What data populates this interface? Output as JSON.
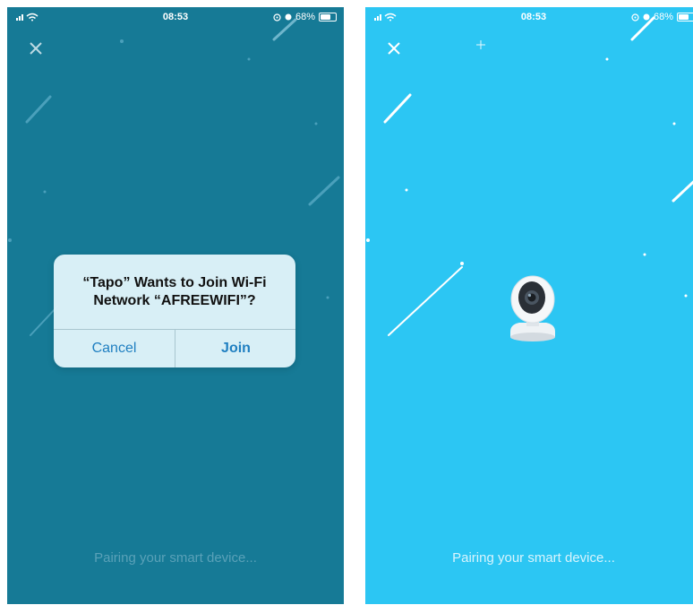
{
  "left_screen": {
    "status": {
      "time": "08:53",
      "battery": "68%",
      "battery_level": 0.68
    },
    "dialog": {
      "title_line1": "“Tapo” Wants to Join Wi-Fi",
      "title_line2": "Network “AFREEWIFI”?",
      "cancel_label": "Cancel",
      "join_label": "Join"
    },
    "footer_text": "Pairing your smart device..."
  },
  "right_screen": {
    "status": {
      "time": "08:53",
      "battery": "68%",
      "battery_level": 0.68
    },
    "footer_text": "Pairing your smart device..."
  },
  "colors": {
    "left_background": "#167a96",
    "right_background": "#2cc6f3",
    "dialog_button_text": "#1f7fc1"
  },
  "icons": {
    "close": "close-icon",
    "signal": "signal-bars-icon",
    "wifi": "wifi-icon",
    "location": "location-icon",
    "alarm": "alarm-icon",
    "battery": "battery-icon",
    "camera": "security-camera-icon"
  }
}
